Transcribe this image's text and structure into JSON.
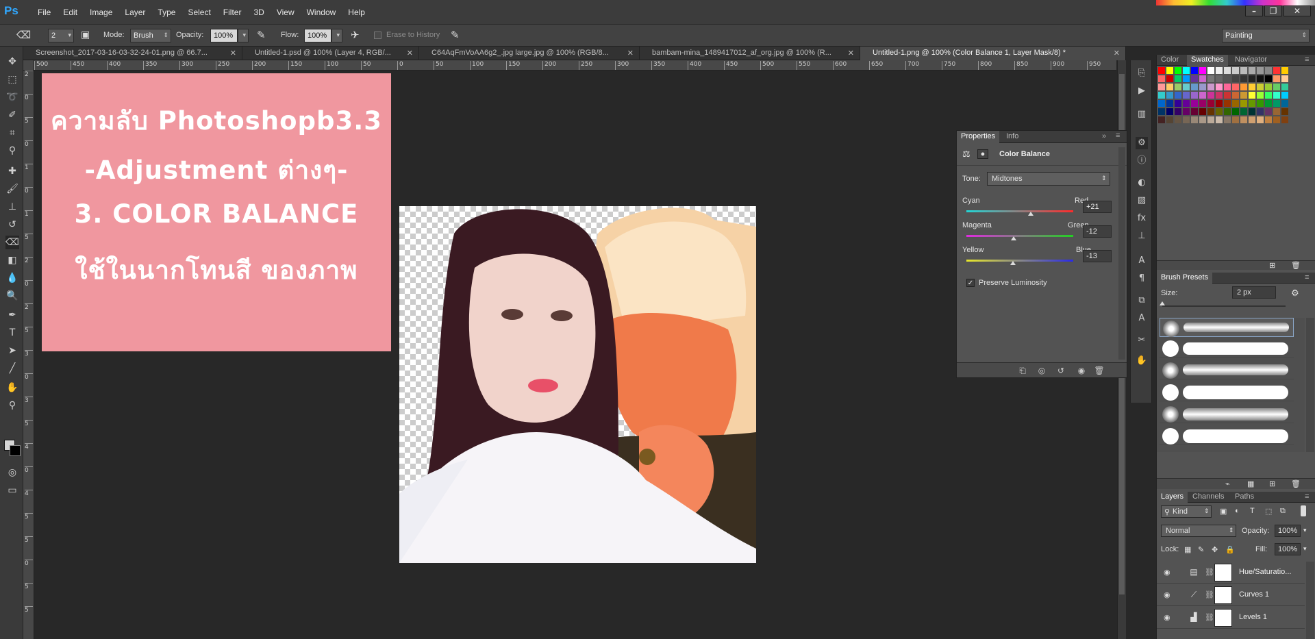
{
  "app": {
    "logo": "Ps"
  },
  "menu": [
    "File",
    "Edit",
    "Image",
    "Layer",
    "Type",
    "Select",
    "Filter",
    "3D",
    "View",
    "Window",
    "Help"
  ],
  "options": {
    "brush_size": "2",
    "mode_label": "Mode:",
    "mode_value": "Brush",
    "opacity_label": "Opacity:",
    "opacity_value": "100%",
    "flow_label": "Flow:",
    "flow_value": "100%",
    "erase_to_history": "Erase to History",
    "workspace": "Painting"
  },
  "doc_tabs": [
    {
      "label": "Screenshot_2017-03-16-03-32-24-01.png @ 66.7...",
      "active": false
    },
    {
      "label": "Untitled-1.psd @ 100% (Layer 4, RGB/...",
      "active": false
    },
    {
      "label": "C64AqFmVoAA6g2_.jpg large.jpg @ 100% (RGB/8...",
      "active": false
    },
    {
      "label": "bambam-mina_1489417012_af_org.jpg @ 100% (R...",
      "active": false
    },
    {
      "label": "Untitled-1.png @ 100% (Color Balance 1, Layer Mask/8) *",
      "active": true
    }
  ],
  "ruler_h": [
    "500",
    "450",
    "400",
    "350",
    "300",
    "250",
    "200",
    "150",
    "100",
    "50",
    "0",
    "50",
    "100",
    "150",
    "200",
    "250",
    "300",
    "350",
    "400",
    "450",
    "500",
    "550",
    "600",
    "650",
    "700",
    "750",
    "800",
    "850",
    "900",
    "950"
  ],
  "ruler_v": [
    "2",
    "0",
    "5",
    "0",
    "1",
    "0",
    "1",
    "5",
    "2",
    "0",
    "2",
    "5",
    "3",
    "0",
    "3",
    "5",
    "4",
    "0",
    "4",
    "5",
    "5",
    "0",
    "5",
    "5"
  ],
  "canvas_card": {
    "line1": "ความลับ Photoshopb3.3",
    "line2": "-Adjustment ต่างๆ-",
    "line3": "3. COLOR BALANCE",
    "line4": "ใช้ในนากโทนสี ของภาพ",
    "bg_color": "#f0979f"
  },
  "properties": {
    "tabs": [
      "Properties",
      "Info"
    ],
    "title": "Color Balance",
    "tone_label": "Tone:",
    "tone_value": "Midtones",
    "sliders": [
      {
        "left": "Cyan",
        "right": "Red",
        "value": "+21",
        "level": 0.6
      },
      {
        "left": "Magenta",
        "right": "Green",
        "value": "-12",
        "level": 0.44
      },
      {
        "left": "Yellow",
        "right": "Blue",
        "value": "-13",
        "level": 0.435
      }
    ],
    "preserve_label": "Preserve Luminosity",
    "preserve_checked": true
  },
  "swatch_tabs": [
    "Color",
    "Swatches",
    "Navigator"
  ],
  "swatches": [
    [
      "#ff0000",
      "#ffff00",
      "#00ff00",
      "#00ffff",
      "#0000ff",
      "#ff00ff",
      "#ffffff",
      "#eeeeee",
      "#dddddd",
      "#cccccc",
      "#bbbbbb",
      "#aaaaaa",
      "#999999",
      "#888888",
      "#ff3333",
      "#ffcc00"
    ],
    [
      "#ff6666",
      "#cc0000",
      "#00cc66",
      "#0099ff",
      "#663399",
      "#cc66cc",
      "#777777",
      "#666666",
      "#555555",
      "#444444",
      "#333333",
      "#222222",
      "#111111",
      "#000000",
      "#ff9966",
      "#ffcc99"
    ],
    [
      "#ff9999",
      "#ffcc66",
      "#99cc66",
      "#66cccc",
      "#6699cc",
      "#9999cc",
      "#cc99cc",
      "#ff99cc",
      "#ff6699",
      "#ff6666",
      "#ff9933",
      "#ffcc33",
      "#cccc33",
      "#99cc33",
      "#66cc66",
      "#33cc99"
    ],
    [
      "#33cccc",
      "#3399cc",
      "#3366cc",
      "#6666cc",
      "#9966cc",
      "#cc66cc",
      "#cc3399",
      "#cc3366",
      "#cc3333",
      "#cc6633",
      "#cc9933",
      "#ffff33",
      "#99ff33",
      "#33ff66",
      "#33ffcc",
      "#00ccff"
    ],
    [
      "#0066cc",
      "#003399",
      "#330099",
      "#660099",
      "#990099",
      "#990066",
      "#990033",
      "#990000",
      "#993300",
      "#996600",
      "#999900",
      "#669900",
      "#339900",
      "#009933",
      "#009966",
      "#006699"
    ],
    [
      "#003366",
      "#000066",
      "#330066",
      "#660066",
      "#660033",
      "#660000",
      "#663300",
      "#666600",
      "#336600",
      "#006600",
      "#006633",
      "#003333",
      "#333366",
      "#663366",
      "#996633",
      "#663300"
    ],
    [
      "#442222",
      "#554433",
      "#665544",
      "#776655",
      "#998877",
      "#aa9988",
      "#bbaa99",
      "#ccbbaa",
      "#887766",
      "#a07040",
      "#c09060",
      "#d0a070",
      "#e0b080",
      "#c08040",
      "#a06020",
      "#804010"
    ]
  ],
  "brush_presets": {
    "title": "Brush Presets",
    "size_label": "Size:",
    "size_value": "2 px"
  },
  "layers_panel": {
    "tabs": [
      "Layers",
      "Channels",
      "Paths"
    ],
    "kind_label": "Kind",
    "blend_mode": "Normal",
    "opacity_label": "Opacity:",
    "opacity_value": "100%",
    "lock_label": "Lock:",
    "fill_label": "Fill:",
    "fill_value": "100%",
    "layers": [
      {
        "name": "Hue/Saturatio...",
        "icon": "hue-saturation-icon"
      },
      {
        "name": "Curves 1",
        "icon": "curves-icon"
      },
      {
        "name": "Levels 1",
        "icon": "levels-icon"
      }
    ]
  }
}
